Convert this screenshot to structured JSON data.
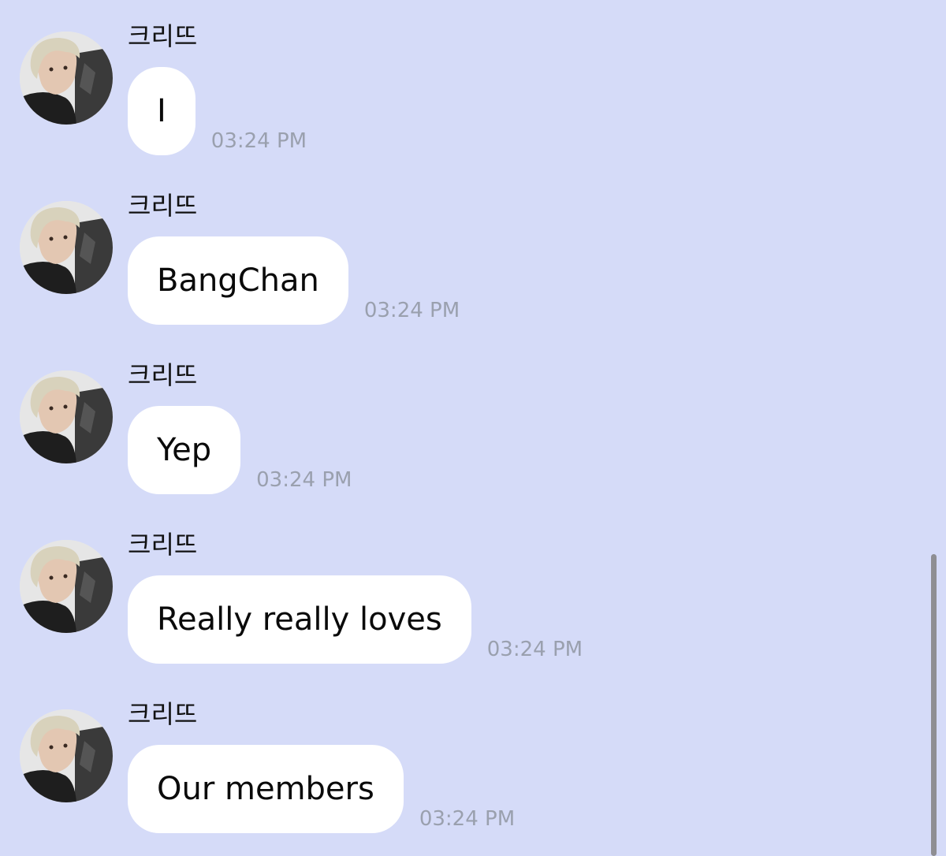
{
  "messages": [
    {
      "sender": "크리뜨",
      "text": "I",
      "time": "03:24 PM"
    },
    {
      "sender": "크리뜨",
      "text": "BangChan",
      "time": "03:24 PM"
    },
    {
      "sender": "크리뜨",
      "text": "Yep",
      "time": "03:24 PM"
    },
    {
      "sender": "크리뜨",
      "text": "Really really loves",
      "time": "03:24 PM"
    },
    {
      "sender": "크리뜨",
      "text": "Our members",
      "time": "03:24 PM"
    }
  ]
}
